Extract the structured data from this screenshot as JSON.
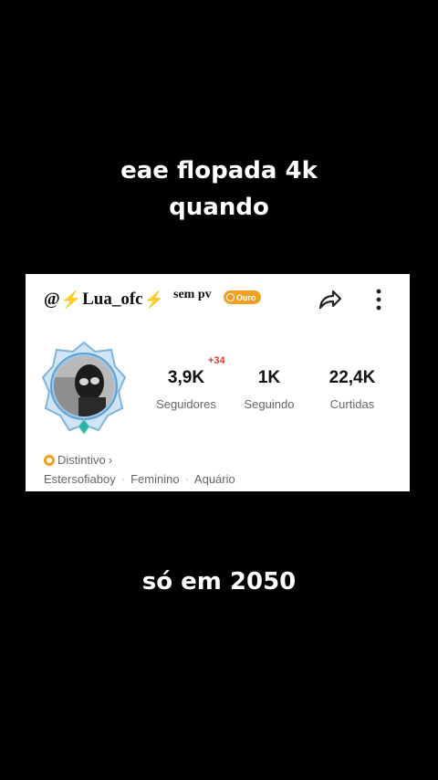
{
  "captions": {
    "top_line1": "eae flopada 4k",
    "top_line2": "quando",
    "bottom": "só em 2050"
  },
  "profile": {
    "at": "@",
    "bolt": "⚡",
    "name": "Lua_ofc",
    "sem_pv": "sem pv",
    "badge": "Ouro",
    "new_followers": "+34",
    "stats": [
      {
        "value": "3,9K",
        "label": "Seguidores"
      },
      {
        "value": "1K",
        "label": "Seguindo"
      },
      {
        "value": "22,4K",
        "label": "Curtidas"
      }
    ],
    "distintivo": "Distintivo",
    "distintivo_chevron": "›",
    "meta": [
      "Estersofiaboy",
      "Feminino",
      "Aquário"
    ],
    "meta_separator": "·"
  },
  "colors": {
    "background": "#000000",
    "card": "#ffffff",
    "badge": "#f0a020",
    "accent_red": "#e53935"
  }
}
